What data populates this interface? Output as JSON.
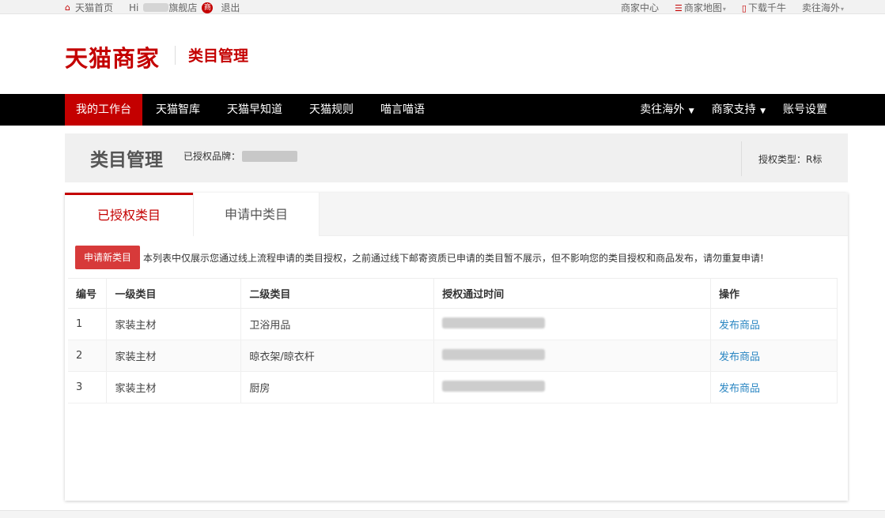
{
  "topbar": {
    "home": "天猫首页",
    "greeting_prefix": "Hi",
    "greeting_suffix": "旗舰店",
    "shop_badge": "商",
    "logout": "退出",
    "merchant_center": "商家中心",
    "merchant_map": "商家地图",
    "download": "下载千牛",
    "overseas": "卖往海外"
  },
  "header": {
    "logo": "天猫商家",
    "subtitle": "类目管理"
  },
  "nav": {
    "items": [
      {
        "label": "我的工作台"
      },
      {
        "label": "天猫智库"
      },
      {
        "label": "天猫早知道"
      },
      {
        "label": "天猫规则"
      },
      {
        "label": "喵言喵语"
      }
    ],
    "right": [
      {
        "label": "卖往海外"
      },
      {
        "label": "商家支持"
      },
      {
        "label": "账号设置"
      }
    ]
  },
  "band": {
    "title": "类目管理",
    "brand_label": "已授权品牌：",
    "auth_type": "授权类型：R标"
  },
  "tabs": {
    "active": "已授权类目",
    "inactive": "申请中类目"
  },
  "notice": {
    "button": "申请新类目",
    "text": "本列表中仅展示您通过线上流程申请的类目授权，之前通过线下邮寄资质已申请的类目暂不展示，但不影响您的类目授权和商品发布，请勿重复申请!"
  },
  "table": {
    "headers": [
      "编号",
      "一级类目",
      "二级类目",
      "授权通过时间",
      "操作"
    ],
    "rows": [
      {
        "no": "1",
        "level1": "家装主材",
        "level2": "卫浴用品",
        "action": "发布商品"
      },
      {
        "no": "2",
        "level1": "家装主材",
        "level2": "晾衣架/晾衣杆",
        "action": "发布商品"
      },
      {
        "no": "3",
        "level1": "家装主材",
        "level2": "厨房",
        "action": "发布商品"
      }
    ]
  },
  "colors": {
    "brand_red": "#c40000",
    "link_blue": "#2a86c2"
  }
}
